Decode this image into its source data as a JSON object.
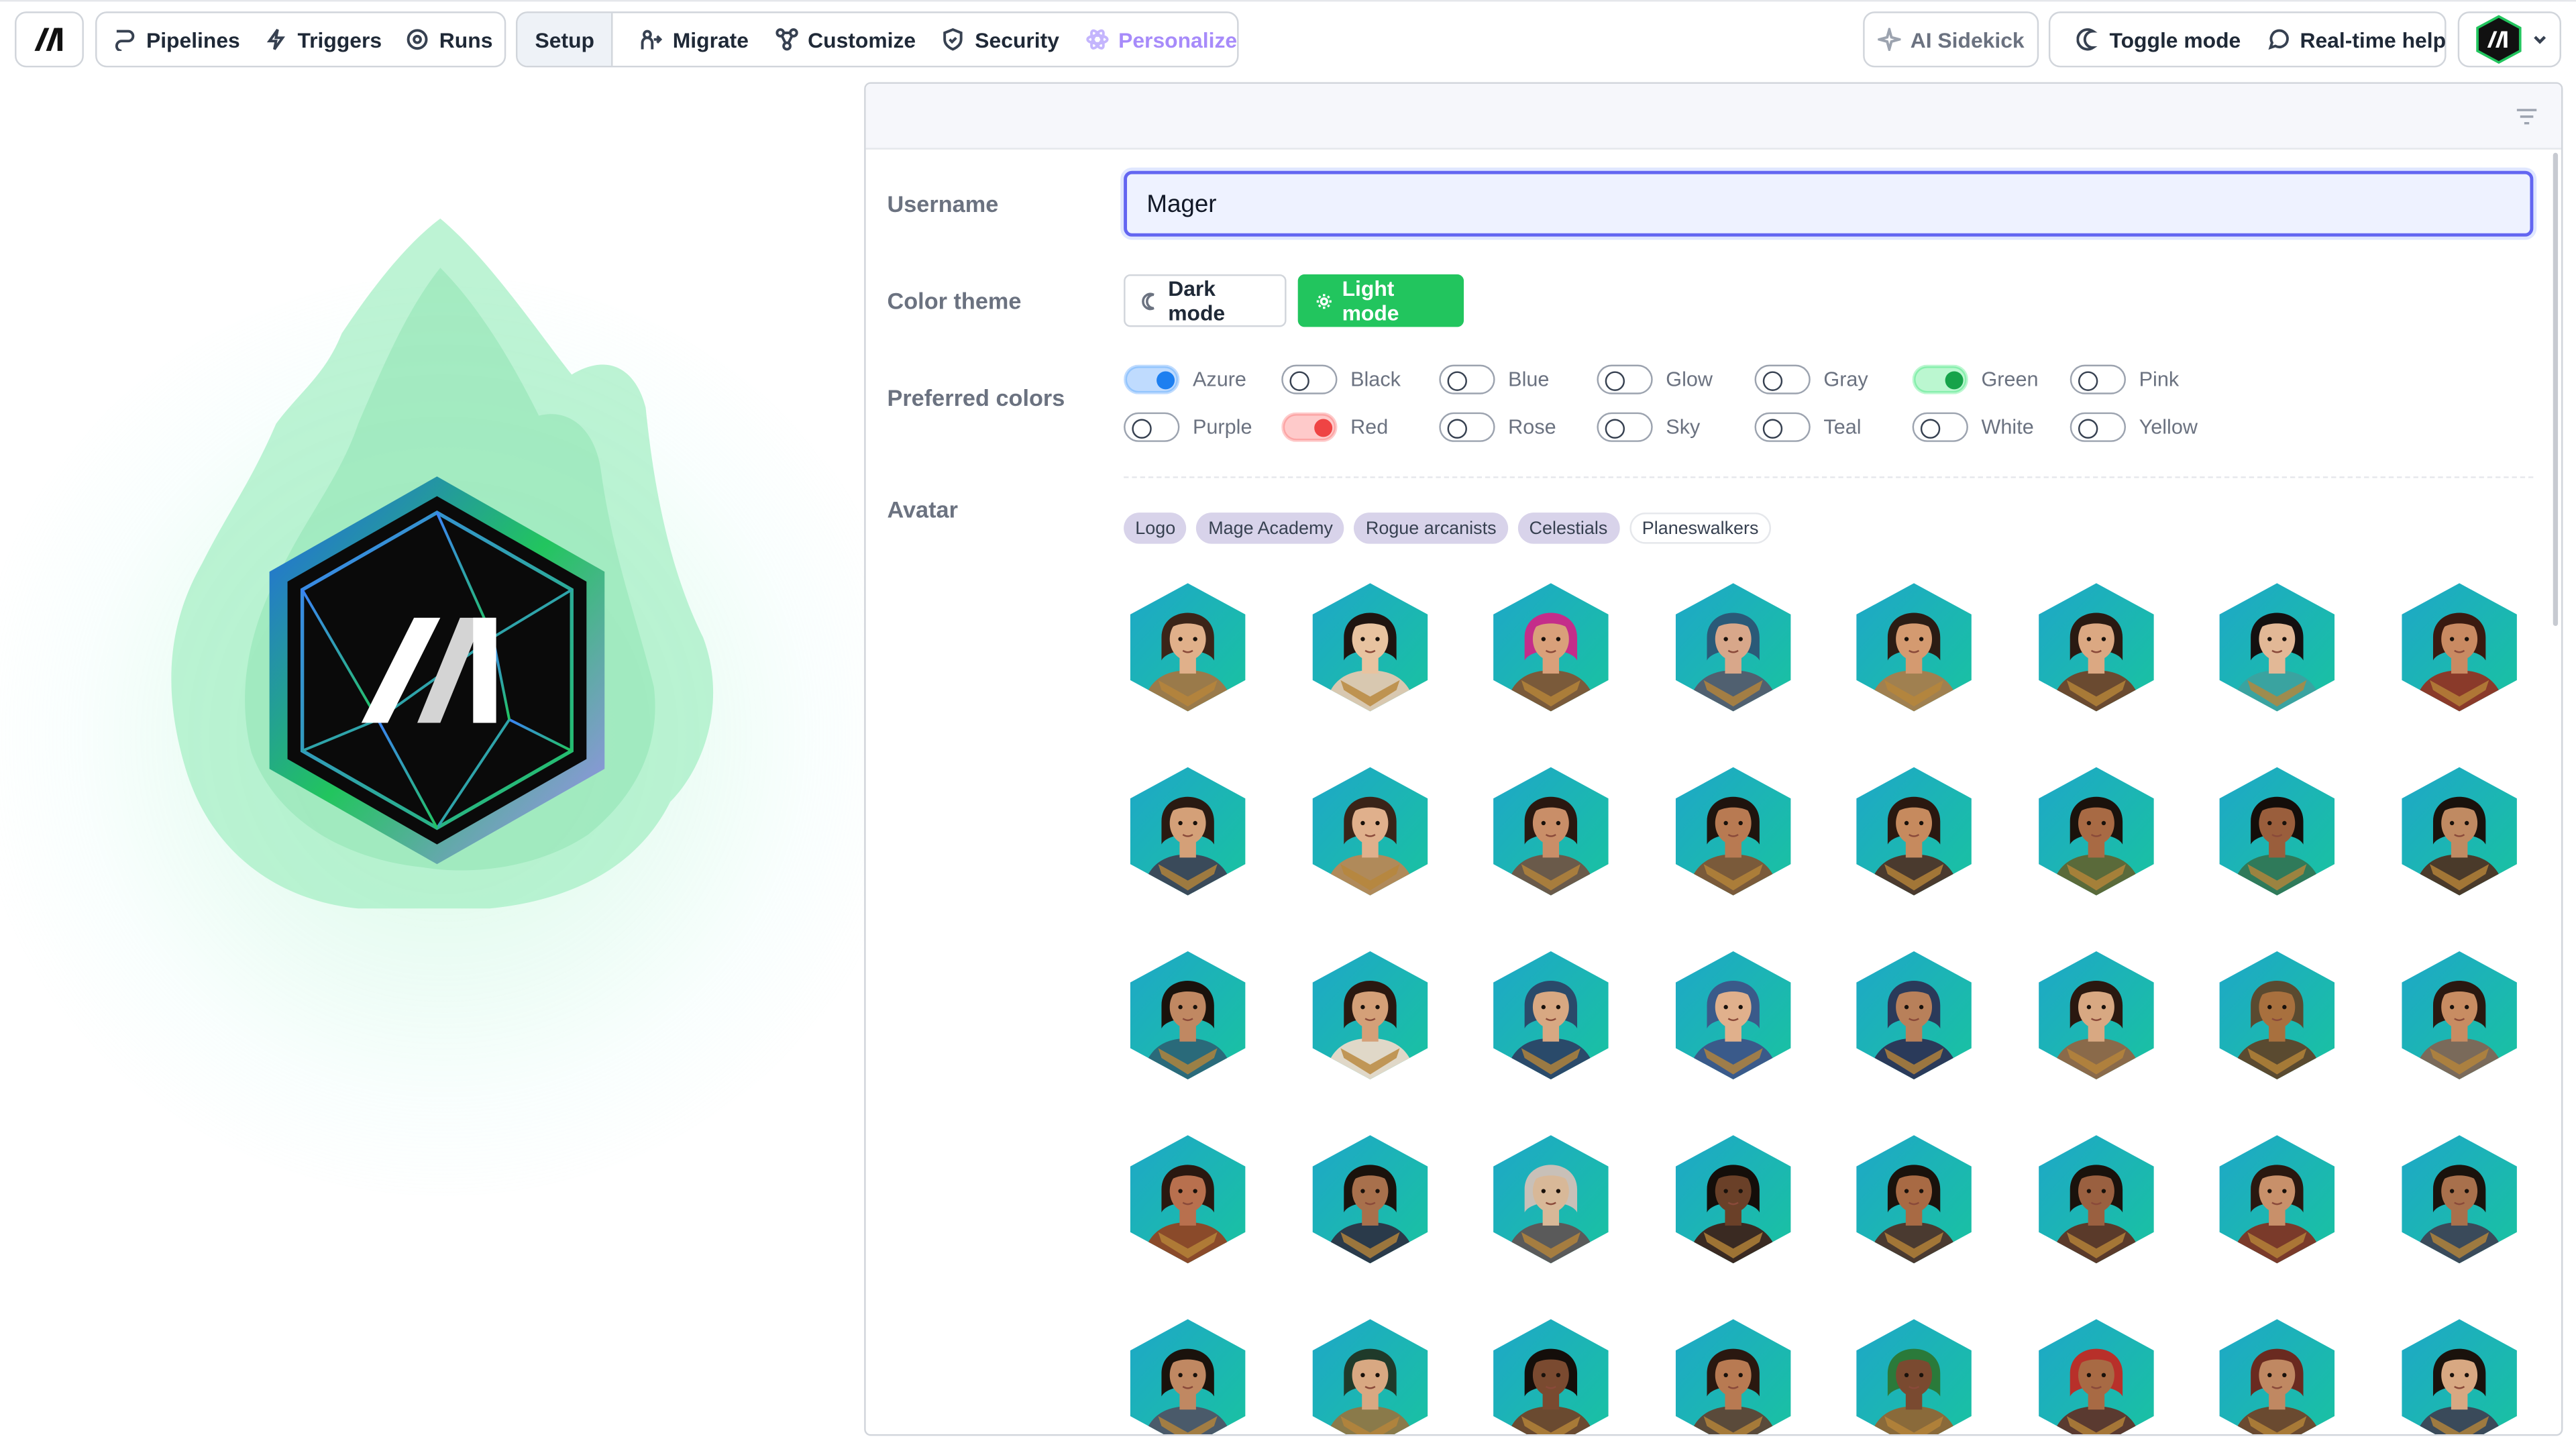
{
  "topbar": {
    "nav_primary": [
      {
        "label": "Pipelines",
        "icon": "pipeline-icon"
      },
      {
        "label": "Triggers",
        "icon": "lightning-icon"
      },
      {
        "label": "Runs",
        "icon": "target-icon"
      }
    ],
    "setup_tab": "Setup",
    "nav_secondary": [
      {
        "label": "Migrate",
        "icon": "migrate-icon"
      },
      {
        "label": "Customize",
        "icon": "nodes-icon"
      },
      {
        "label": "Security",
        "icon": "shield-icon"
      },
      {
        "label": "Personalize",
        "icon": "atom-icon",
        "active": true
      }
    ],
    "ai_sidekick": "AI Sidekick",
    "toggle_mode": "Toggle mode",
    "realtime_help": "Real-time help"
  },
  "form": {
    "username_label": "Username",
    "username_value": "Mager",
    "theme_label": "Color theme",
    "dark_mode": "Dark mode",
    "light_mode": "Light mode",
    "colors_label": "Preferred colors",
    "colors": [
      {
        "name": "Azure",
        "on": true,
        "swatch": "#1d7ff0"
      },
      {
        "name": "Black",
        "on": false
      },
      {
        "name": "Blue",
        "on": false
      },
      {
        "name": "Glow",
        "on": false
      },
      {
        "name": "Gray",
        "on": false
      },
      {
        "name": "Green",
        "on": true,
        "swatch": "#16a34a"
      },
      {
        "name": "Pink",
        "on": false
      },
      {
        "name": "Purple",
        "on": false
      },
      {
        "name": "Red",
        "on": true,
        "swatch": "#ef4444"
      },
      {
        "name": "Rose",
        "on": false
      },
      {
        "name": "Sky",
        "on": false
      },
      {
        "name": "Teal",
        "on": false
      },
      {
        "name": "White",
        "on": false
      },
      {
        "name": "Yellow",
        "on": false
      }
    ],
    "avatar_label": "Avatar",
    "avatar_tabs": [
      "Logo",
      "Mage Academy",
      "Rogue arcanists",
      "Celestials",
      "Planeswalkers"
    ],
    "avatars": [
      {
        "skin": "#e0b08a",
        "hair": "#3b2418",
        "outfit": "#9a7a4a"
      },
      {
        "skin": "#e8c3a0",
        "hair": "#1f1410",
        "outfit": "#d8c8b0"
      },
      {
        "skin": "#d9a07a",
        "hair": "#c42d8a",
        "outfit": "#7a5a3a"
      },
      {
        "skin": "#d8a78a",
        "hair": "#2a5a78",
        "outfit": "#506070"
      },
      {
        "skin": "#d49a70",
        "hair": "#2b1c14",
        "outfit": "#a08050"
      },
      {
        "skin": "#dba882",
        "hair": "#2a1a12",
        "outfit": "#6a4a30"
      },
      {
        "skin": "#e2b896",
        "hair": "#141010",
        "outfit": "#3aa3a0"
      },
      {
        "skin": "#c98a62",
        "hair": "#3a1a10",
        "outfit": "#8a3a2a"
      },
      {
        "skin": "#d4a078",
        "hair": "#2a1a12",
        "outfit": "#3a4a5a"
      },
      {
        "skin": "#e0b08c",
        "hair": "#3a2418",
        "outfit": "#b08a5a"
      },
      {
        "skin": "#c98e68",
        "hair": "#2a1810",
        "outfit": "#6a5a4a"
      },
      {
        "skin": "#b87a52",
        "hair": "#1f140e",
        "outfit": "#7a5a3a"
      },
      {
        "skin": "#c68a5e",
        "hair": "#2a1810",
        "outfit": "#4a3a2e"
      },
      {
        "skin": "#a86a44",
        "hair": "#1a120c",
        "outfit": "#5a6a3a"
      },
      {
        "skin": "#9a5e3c",
        "hair": "#140e0a",
        "outfit": "#2f7a5a"
      },
      {
        "skin": "#c08a62",
        "hair": "#1a120c",
        "outfit": "#4a3a2a"
      },
      {
        "skin": "#c08862",
        "hair": "#1a120c",
        "outfit": "#2a6a7a"
      },
      {
        "skin": "#d4a078",
        "hair": "#2a1810",
        "outfit": "#e0d8c8"
      },
      {
        "skin": "#d8a882",
        "hair": "#2a4a6a",
        "outfit": "#2a4a6a"
      },
      {
        "skin": "#e0b08c",
        "hair": "#3a5a8a",
        "outfit": "#3a5a8a"
      },
      {
        "skin": "#b8805a",
        "hair": "#2a3a5a",
        "outfit": "#2a3a5a"
      },
      {
        "skin": "#d8a882",
        "hair": "#2a1810",
        "outfit": "#8a6a4a"
      },
      {
        "skin": "#a8703e",
        "hair": "#5a4a30",
        "outfit": "#5a4a30"
      },
      {
        "skin": "#c88c62",
        "hair": "#2a1810",
        "outfit": "#7a6a5a"
      },
      {
        "skin": "#b8704e",
        "hair": "#2a1810",
        "outfit": "#8a4a2a"
      },
      {
        "skin": "#a8704c",
        "hair": "#1a120c",
        "outfit": "#2a3a4a"
      },
      {
        "skin": "#d8b898",
        "hair": "#c8c0b8",
        "outfit": "#5a5a5a"
      },
      {
        "skin": "#6a4028",
        "hair": "#140e0a",
        "outfit": "#3a2a22"
      },
      {
        "skin": "#a86a44",
        "hair": "#1a120c",
        "outfit": "#4a3a30"
      },
      {
        "skin": "#9a6040",
        "hair": "#1a120c",
        "outfit": "#5a3a2a"
      },
      {
        "skin": "#c8906a",
        "hair": "#2a1810",
        "outfit": "#7a3a2a"
      },
      {
        "skin": "#a8704c",
        "hair": "#1a120c",
        "outfit": "#3a4a5a"
      },
      {
        "skin": "#c08862",
        "hair": "#1a120c",
        "outfit": "#4a5a6a"
      },
      {
        "skin": "#d8a882",
        "hair": "#1f3a2a",
        "outfit": "#8a7a4a"
      },
      {
        "skin": "#7a4a30",
        "hair": "#140e0a",
        "outfit": "#6a4a30"
      },
      {
        "skin": "#b87a52",
        "hair": "#2a1810",
        "outfit": "#5a4a3a"
      },
      {
        "skin": "#7a4a30",
        "hair": "#2a7a3a",
        "outfit": "#8a6a3a"
      },
      {
        "skin": "#a86a44",
        "hair": "#b8302a",
        "outfit": "#5a3a30"
      },
      {
        "skin": "#c08862",
        "hair": "#6a2a20",
        "outfit": "#6a4a30"
      },
      {
        "skin": "#d8a882",
        "hair": "#1a120c",
        "outfit": "#3a4a5a"
      }
    ]
  },
  "colors": {
    "accent": "#6366f1",
    "success": "#22c55e",
    "personalize": "#a78bfa"
  }
}
